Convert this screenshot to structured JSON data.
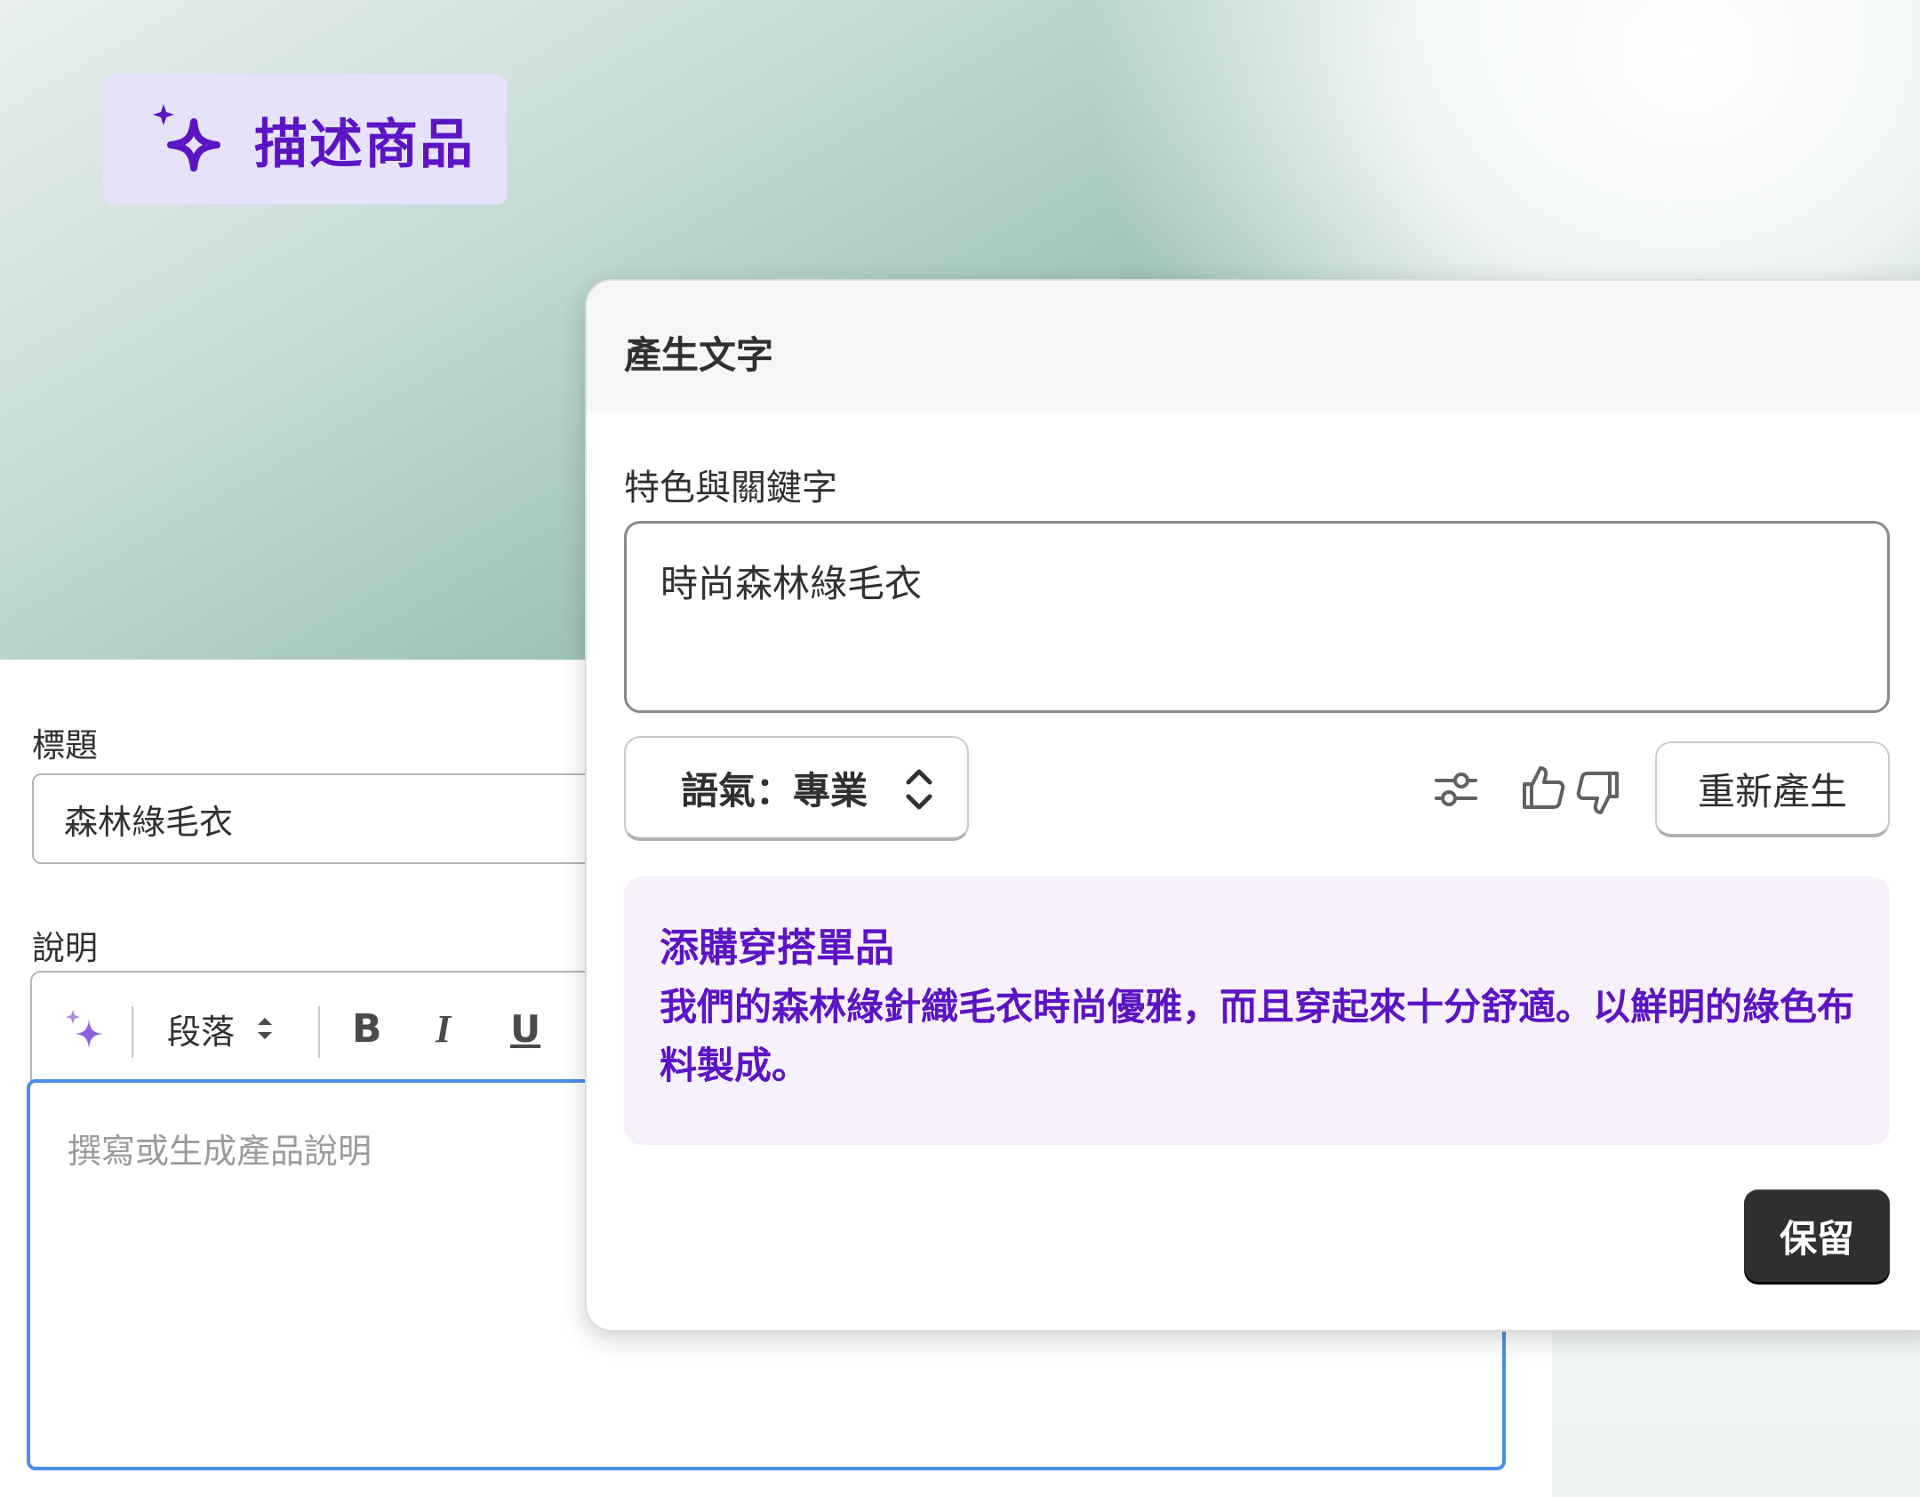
{
  "hero": {
    "badge_label": "描述商品"
  },
  "form": {
    "title_label": "標題",
    "title_value": "森林綠毛衣",
    "description_label": "說明",
    "toolbar": {
      "paragraph_label": "段落",
      "bold": "B",
      "italic": "I",
      "underline": "U"
    },
    "description_placeholder": "撰寫或生成產品說明"
  },
  "popover": {
    "title": "產生文字",
    "keywords_label": "特色與關鍵字",
    "keywords_value": "時尚森林綠毛衣",
    "tone_label": "語氣：專業",
    "regenerate_label": "重新產生",
    "result": {
      "title": "添購穿搭單品",
      "body": "我們的森林綠針織毛衣時尚優雅，而且穿起來十分舒適。以鮮明的綠色布料製成。"
    },
    "keep_label": "保留"
  },
  "colors": {
    "accent": "#5c14c4",
    "focus": "#4a8ee8",
    "primary_button": "#303030"
  }
}
